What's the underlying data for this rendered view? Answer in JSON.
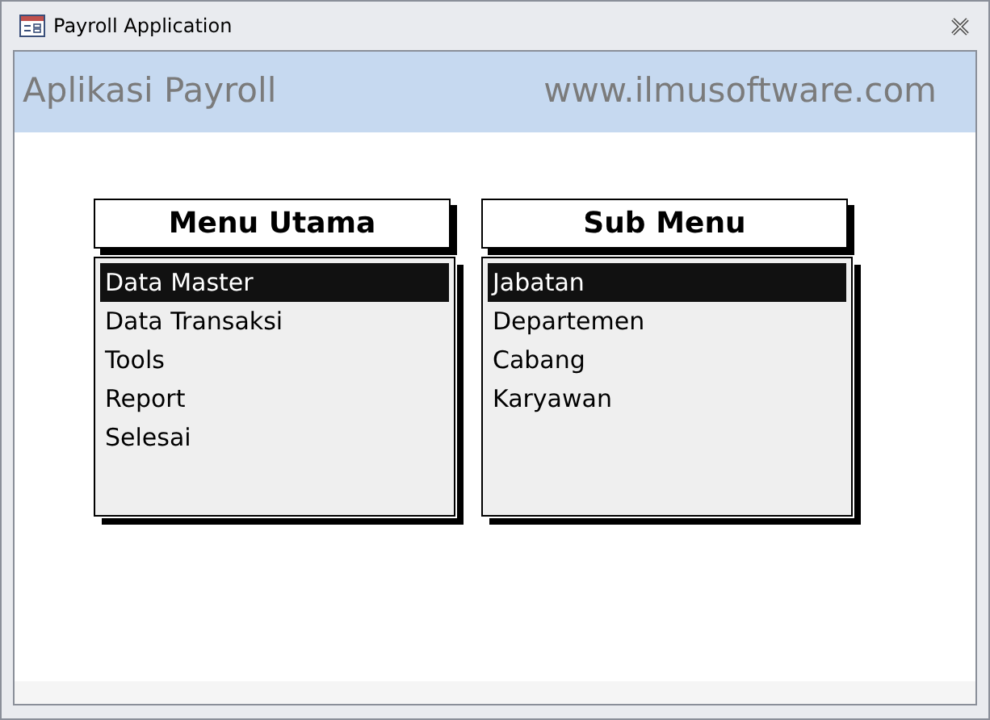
{
  "window": {
    "title": "Payroll Application"
  },
  "header": {
    "title": "Aplikasi Payroll",
    "website": "www.ilmusoftware.com"
  },
  "menus": [
    {
      "title": "Menu Utama",
      "items": [
        {
          "label": "Data Master",
          "selected": true
        },
        {
          "label": "Data Transaksi",
          "selected": false
        },
        {
          "label": "Tools",
          "selected": false
        },
        {
          "label": "Report",
          "selected": false
        },
        {
          "label": "Selesai",
          "selected": false
        }
      ]
    },
    {
      "title": "Sub Menu",
      "items": [
        {
          "label": "Jabatan",
          "selected": true
        },
        {
          "label": "Departemen",
          "selected": false
        },
        {
          "label": "Cabang",
          "selected": false
        },
        {
          "label": "Karyawan",
          "selected": false
        }
      ]
    }
  ]
}
